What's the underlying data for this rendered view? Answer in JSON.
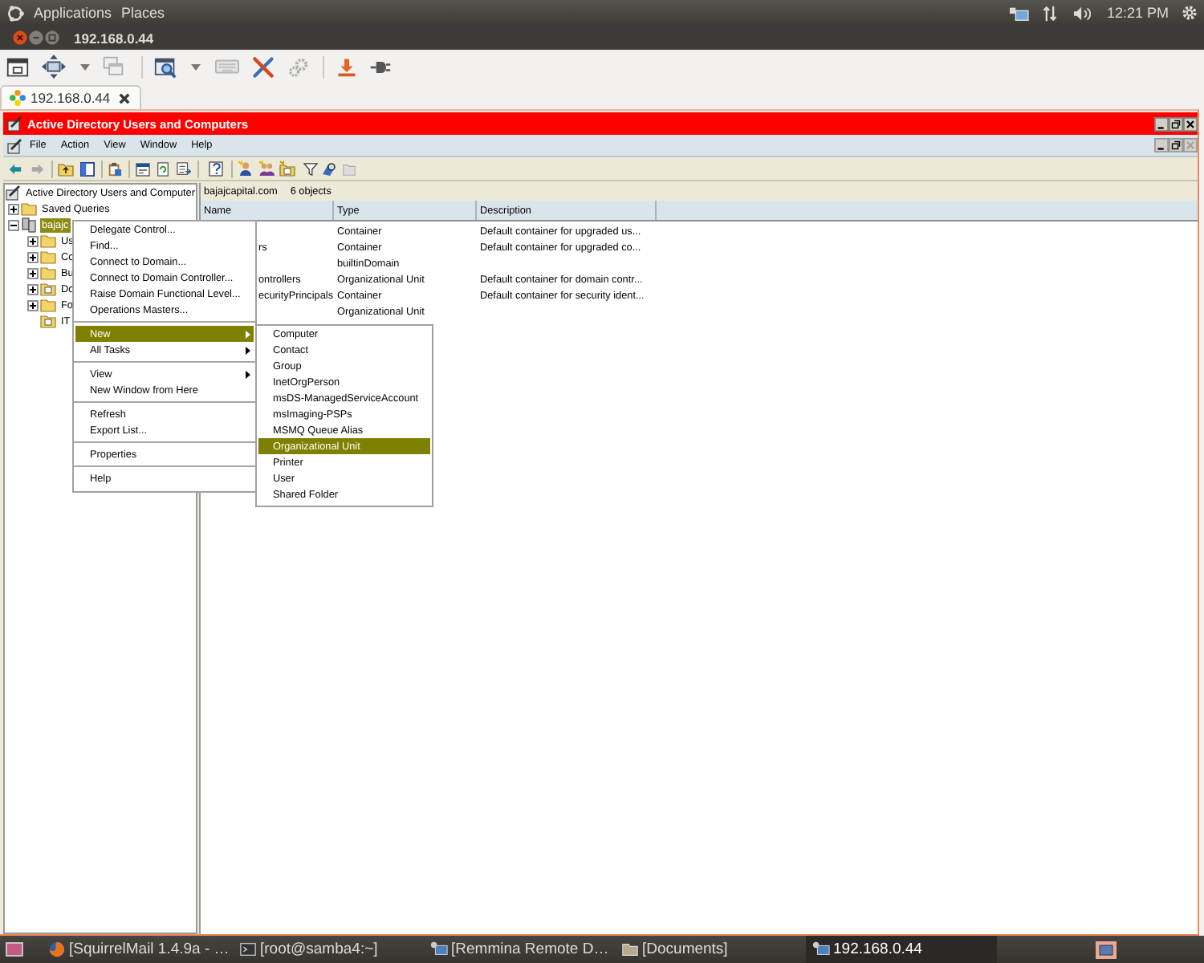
{
  "top_panel": {
    "menus": [
      "Applications",
      "Places"
    ],
    "clock": "12:21 PM"
  },
  "window": {
    "title": "192.168.0.44"
  },
  "tabs": [
    {
      "label": "192.168.0.44",
      "selected": true
    }
  ],
  "remote_app": {
    "title": "Active Directory Users and Computers",
    "menu": [
      "File",
      "Action",
      "View",
      "Window",
      "Help"
    ]
  },
  "tree": {
    "label": "Active Directory Users and Computer",
    "children": [
      {
        "label": "Saved Queries",
        "kind": "folder",
        "expanded": false,
        "selected": false
      },
      {
        "label": "bajajc",
        "kind": "domain",
        "expanded": true,
        "selected": true,
        "children": [
          {
            "label": "Us",
            "kind": "folder",
            "expanded": false,
            "selected": false
          },
          {
            "label": "Co",
            "kind": "folder",
            "expanded": false,
            "selected": false
          },
          {
            "label": "Bu",
            "kind": "folder",
            "expanded": false,
            "selected": false
          },
          {
            "label": "Do",
            "kind": "ou",
            "expanded": false,
            "selected": false
          },
          {
            "label": "Fo",
            "kind": "folder",
            "expanded": false,
            "selected": false
          },
          {
            "label": "IT",
            "kind": "ou",
            "selected": false
          }
        ]
      }
    ]
  },
  "list": {
    "path": "bajajcapital.com",
    "count": "6 objects",
    "columns": [
      "Name",
      "Type",
      "Description"
    ],
    "rows": [
      {
        "type": "Container",
        "description": "Default container for upgraded us..."
      },
      {
        "name": "rs",
        "type": "Container",
        "description": "Default container for upgraded co..."
      },
      {
        "type": "builtinDomain"
      },
      {
        "name": "ontrollers",
        "type": "Organizational Unit",
        "description": "Default container for domain contr..."
      },
      {
        "name": "ecurityPrincipals",
        "type": "Container",
        "description": "Default container for security ident..."
      },
      {
        "type": "Organizational Unit"
      }
    ]
  },
  "context_menu": {
    "groups": [
      [
        {
          "label": "Delegate Control...",
          "submenu": false,
          "selected": false
        },
        {
          "label": "Find...",
          "submenu": false,
          "selected": false
        },
        {
          "label": "Connect to Domain...",
          "submenu": false,
          "selected": false
        },
        {
          "label": "Connect to Domain Controller...",
          "submenu": false,
          "selected": false
        },
        {
          "label": "Raise Domain Functional Level...",
          "submenu": false,
          "selected": false
        },
        {
          "label": "Operations Masters...",
          "submenu": false,
          "selected": false
        }
      ],
      [
        {
          "label": "New",
          "submenu": true,
          "selected": true
        },
        {
          "label": "All Tasks",
          "submenu": true,
          "selected": false
        }
      ],
      [
        {
          "label": "View",
          "submenu": true,
          "selected": false
        },
        {
          "label": "New Window from Here",
          "submenu": false,
          "selected": false
        }
      ],
      [
        {
          "label": "Refresh",
          "submenu": false,
          "selected": false
        },
        {
          "label": "Export List...",
          "submenu": false,
          "selected": false
        }
      ],
      [
        {
          "label": "Properties",
          "submenu": false,
          "selected": false
        }
      ],
      [
        {
          "label": "Help",
          "submenu": false,
          "selected": false
        }
      ]
    ]
  },
  "new_submenu": {
    "items": [
      {
        "label": "Computer",
        "selected": false
      },
      {
        "label": "Contact",
        "selected": false
      },
      {
        "label": "Group",
        "selected": false
      },
      {
        "label": "InetOrgPerson",
        "selected": false
      },
      {
        "label": "msDS-ManagedServiceAccount",
        "selected": false
      },
      {
        "label": "msImaging-PSPs",
        "selected": false
      },
      {
        "label": "MSMQ Queue Alias",
        "selected": false
      },
      {
        "label": "Organizational Unit",
        "selected": true
      },
      {
        "label": "Printer",
        "selected": false
      },
      {
        "label": "User",
        "selected": false
      },
      {
        "label": "Shared Folder",
        "selected": false
      }
    ]
  },
  "taskbar": {
    "items": [
      {
        "label": "[SquirrelMail 1.4.9a - …",
        "kind": "browser",
        "selected": false
      },
      {
        "label": "[root@samba4:~]",
        "kind": "terminal",
        "selected": false
      },
      {
        "label": "[Remmina Remote D…",
        "kind": "remote",
        "selected": false
      },
      {
        "label": "[Documents]",
        "kind": "folder",
        "selected": false
      },
      {
        "label": "192.168.0.44",
        "kind": "remote",
        "selected": true
      }
    ]
  }
}
